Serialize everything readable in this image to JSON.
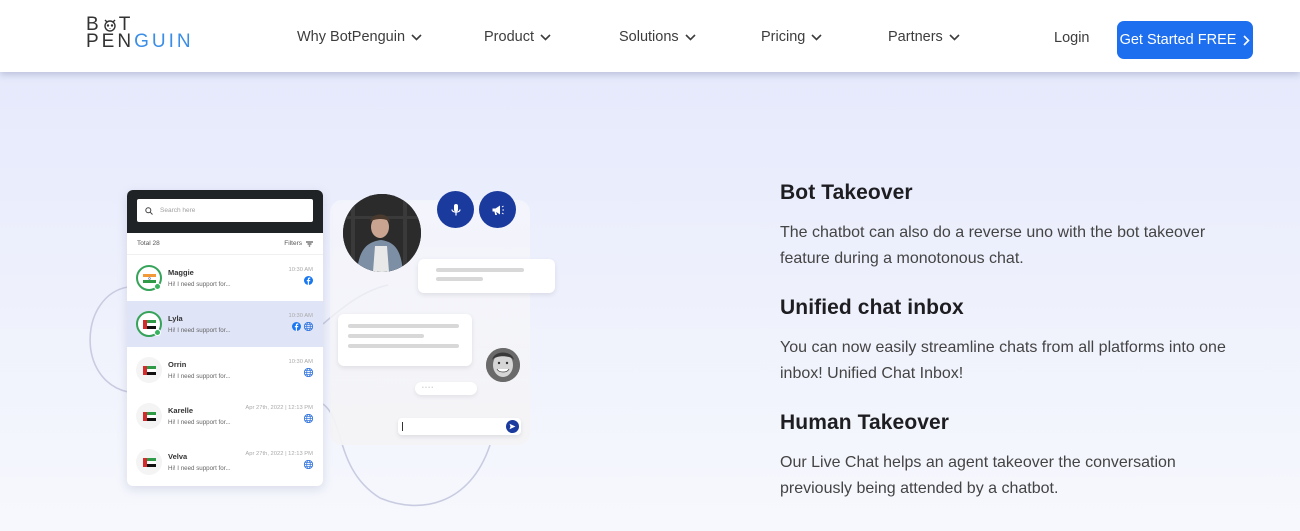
{
  "header": {
    "logo": {
      "line1_left": "B",
      "line1_right": "T",
      "line2_dark": "PEN",
      "line2_blue": "GUIN"
    },
    "nav": [
      {
        "label": "Why BotPenguin"
      },
      {
        "label": "Product"
      },
      {
        "label": "Solutions"
      },
      {
        "label": "Pricing"
      },
      {
        "label": "Partners"
      }
    ],
    "login_label": "Login",
    "cta_label": "Get Started FREE",
    "cta_color": "#1e6ff0"
  },
  "illustration": {
    "search_placeholder": "Search here",
    "total_label": "Total 28",
    "filters_label": "Filters",
    "conversations": [
      {
        "name": "Maggie",
        "message": "Hi! I need support for...",
        "time": "10:30 AM",
        "flag": "india",
        "online": true,
        "active": false,
        "channels": [
          "facebook"
        ]
      },
      {
        "name": "Lyla",
        "message": "Hi! I need support for...",
        "time": "10:30 AM",
        "flag": "uae",
        "online": true,
        "active": true,
        "channels": [
          "facebook",
          "web"
        ]
      },
      {
        "name": "Orrin",
        "message": "Hi! I need support for...",
        "time": "10:30 AM",
        "flag": "uae",
        "online": false,
        "active": false,
        "channels": [
          "web"
        ]
      },
      {
        "name": "Karelle",
        "message": "Hi! I need support for...",
        "time": "Apr 27th, 2022 | 12:13 PM",
        "flag": "uae",
        "online": false,
        "active": false,
        "channels": [
          "web"
        ]
      },
      {
        "name": "Velva",
        "message": "Hi! I need support for...",
        "time": "Apr 27th, 2022 | 12:13 PM",
        "flag": "uae",
        "online": false,
        "active": false,
        "channels": [
          "web"
        ]
      }
    ],
    "typing_placeholder": "• • • •",
    "accent_color": "#1a3a9e"
  },
  "features": [
    {
      "title": "Bot Takeover",
      "description": "The chatbot can also do a reverse uno with the bot takeover feature during a monotonous chat."
    },
    {
      "title": "Unified chat inbox",
      "description": "You can now easily streamline chats from all platforms into one inbox! Unified Chat Inbox!"
    },
    {
      "title": "Human Takeover",
      "description": "Our Live Chat helps an agent takeover the conversation previously being attended by a chatbot."
    }
  ]
}
